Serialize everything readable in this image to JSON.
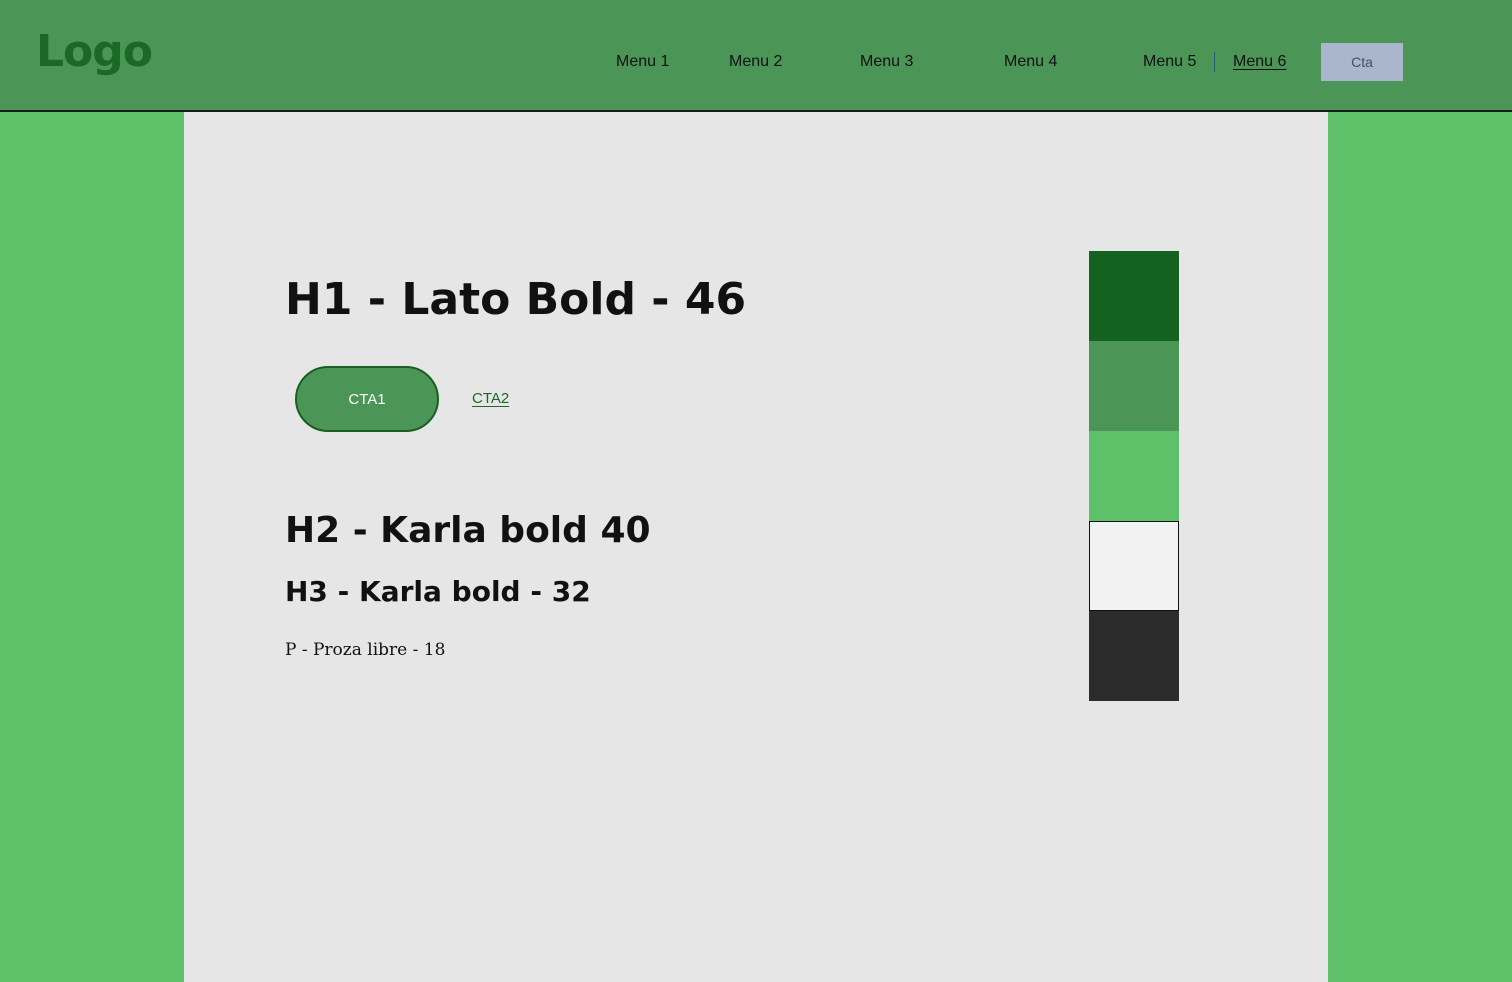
{
  "header": {
    "logo": "Logo",
    "menu": [
      "Menu 1",
      "Menu 2",
      "Menu 3",
      "Menu 4",
      "Menu 5",
      "Menu 6"
    ],
    "cta_label": "Cta"
  },
  "content": {
    "h1": "H1 - Lato Bold - 46",
    "cta1_label": "CTA1",
    "cta2_label": "CTA2",
    "h2": "H2 - Karla bold 40",
    "h3": "H3 - Karla bold - 32",
    "paragraph": "P - Proza libre - 18"
  },
  "palette": [
    {
      "name": "dark-green",
      "color": "#14621f"
    },
    {
      "name": "medium-green",
      "color": "#4b9656"
    },
    {
      "name": "light-green",
      "color": "#5ec16a"
    },
    {
      "name": "off-white",
      "color": "#f2f2f2"
    },
    {
      "name": "charcoal",
      "color": "#2c2c2c"
    }
  ],
  "colors": {
    "page_background": "#5ec16a",
    "header_background": "#4b9656",
    "panel_background": "#e6e6e6",
    "logo_color": "#1a6a25",
    "cta_top_background": "#a9b6cc"
  }
}
